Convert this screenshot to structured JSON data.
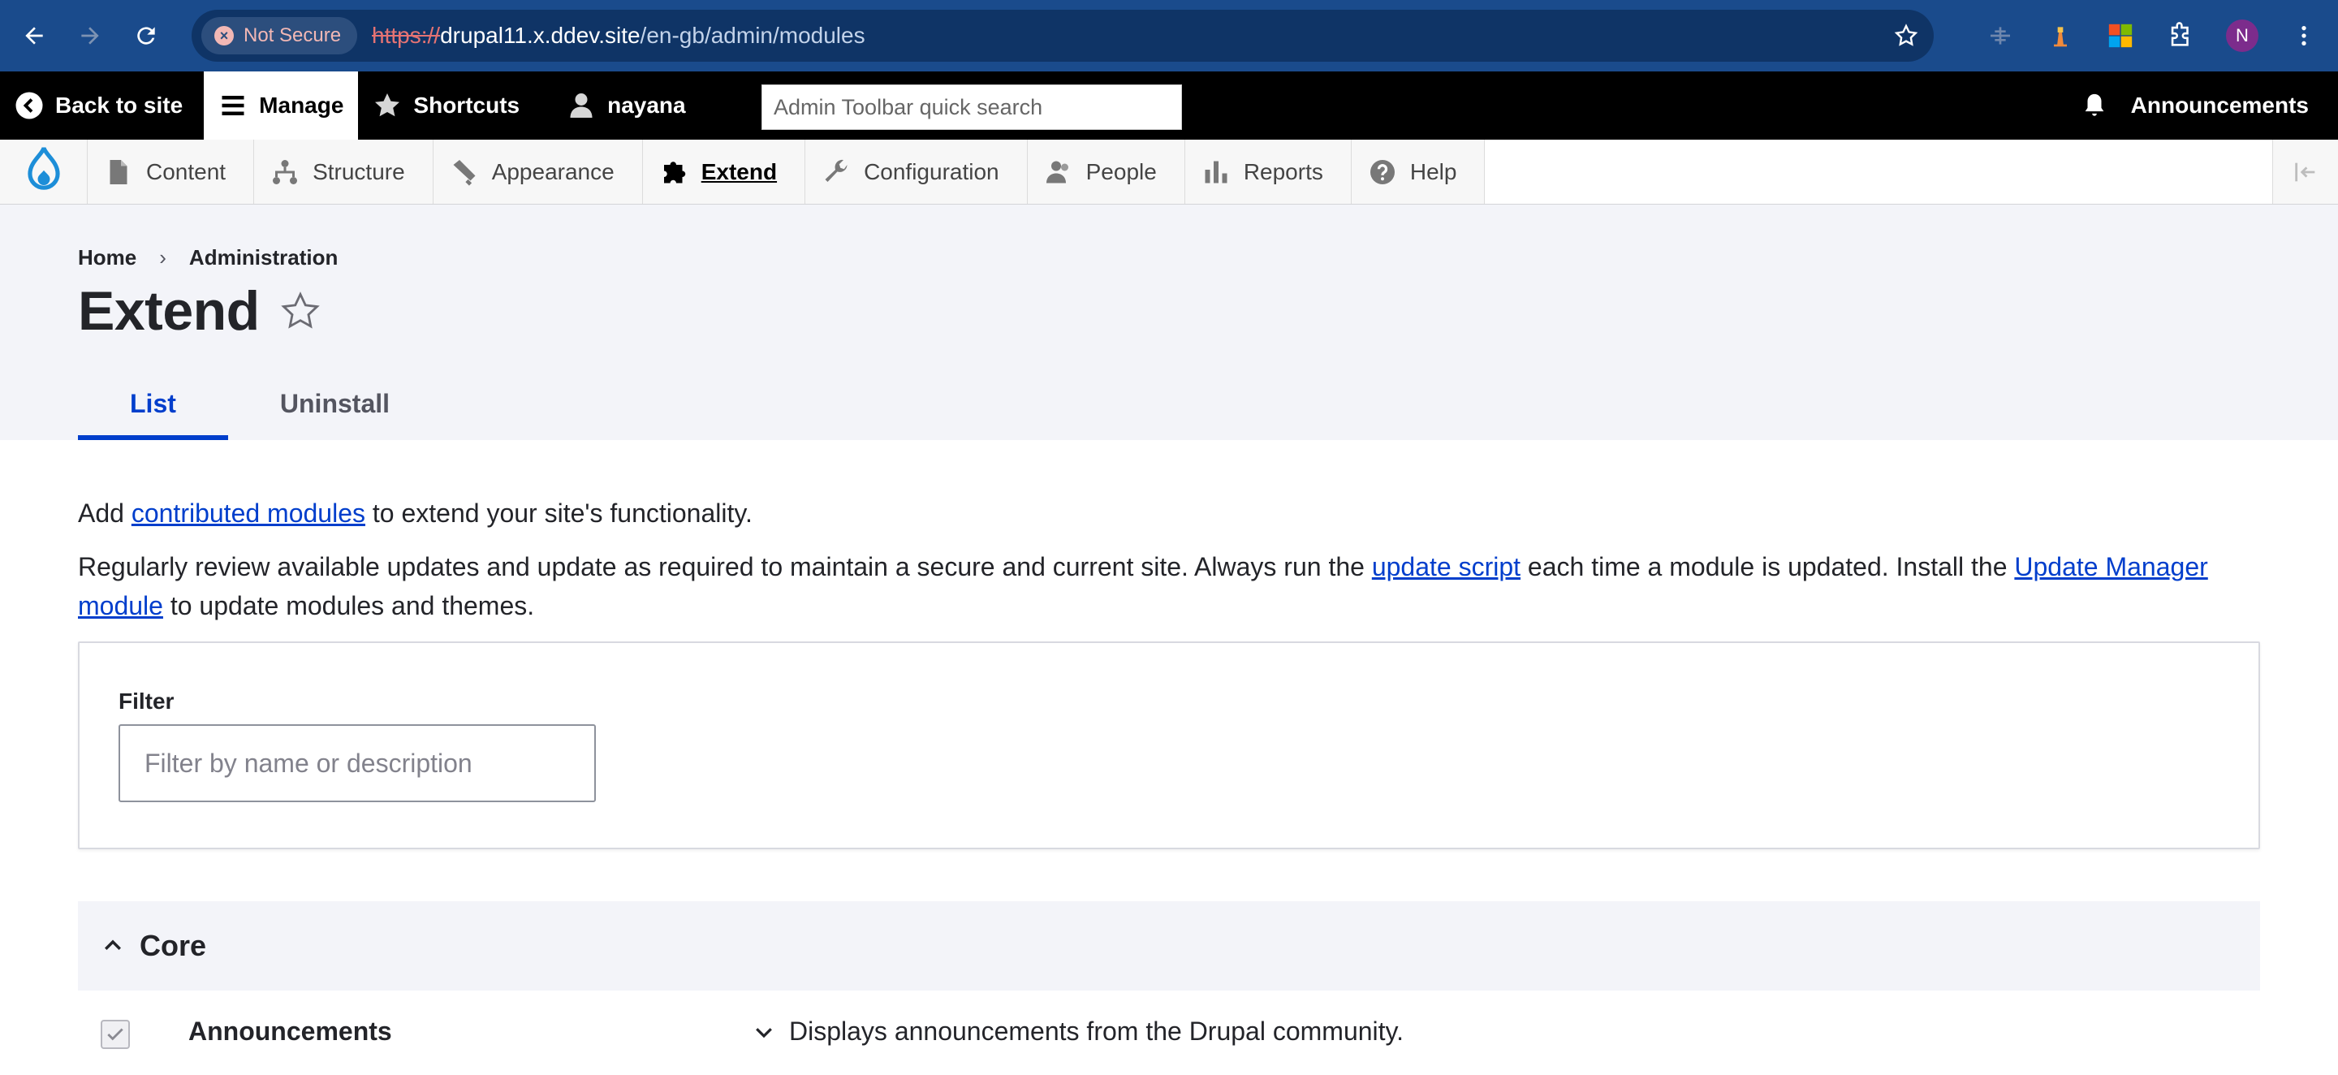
{
  "browser": {
    "security_label": "Not Secure",
    "url_scheme": "https://",
    "url_host": "drupal11.x.ddev.site",
    "url_path": "/en-gb/admin/modules",
    "avatar_letter": "N"
  },
  "admin_toolbar": {
    "back_label": "Back to site",
    "manage_label": "Manage",
    "shortcuts_label": "Shortcuts",
    "user_label": "nayana",
    "quick_search_placeholder": "Admin Toolbar quick search",
    "announcements_label": "Announcements"
  },
  "tray": {
    "items": [
      {
        "label": "Content",
        "icon": "file-icon"
      },
      {
        "label": "Structure",
        "icon": "structure-icon"
      },
      {
        "label": "Appearance",
        "icon": "paintbrush-icon"
      },
      {
        "label": "Extend",
        "icon": "puzzle-icon"
      },
      {
        "label": "Configuration",
        "icon": "wrench-icon"
      },
      {
        "label": "People",
        "icon": "people-icon"
      },
      {
        "label": "Reports",
        "icon": "bar-chart-icon"
      },
      {
        "label": "Help",
        "icon": "help-icon"
      }
    ]
  },
  "breadcrumb": {
    "home": "Home",
    "separator": "›",
    "admin": "Administration"
  },
  "page": {
    "title": "Extend",
    "tabs": [
      {
        "label": "List",
        "active": true
      },
      {
        "label": "Uninstall",
        "active": false
      }
    ],
    "intro": {
      "prefix": "Add ",
      "link": "contributed modules",
      "suffix": " to extend your site's functionality."
    },
    "notice": {
      "part1": "Regularly review available updates and update as required to maintain a secure and current site. Always run the ",
      "link1": "update script",
      "part2": " each time a module is updated. Install the ",
      "link2": "Update Manager module",
      "part3": " to update modules and themes."
    },
    "filter": {
      "label": "Filter",
      "placeholder": "Filter by name or description"
    },
    "core": {
      "heading": "Core",
      "modules": [
        {
          "name": "Announcements",
          "description": "Displays announcements from the Drupal community.",
          "checked": true
        }
      ]
    }
  },
  "colors": {
    "chrome_bg": "#1a4b8c",
    "admin_bar_bg": "#000000",
    "link": "#003ecc",
    "page_head_bg": "#f3f4f9"
  }
}
